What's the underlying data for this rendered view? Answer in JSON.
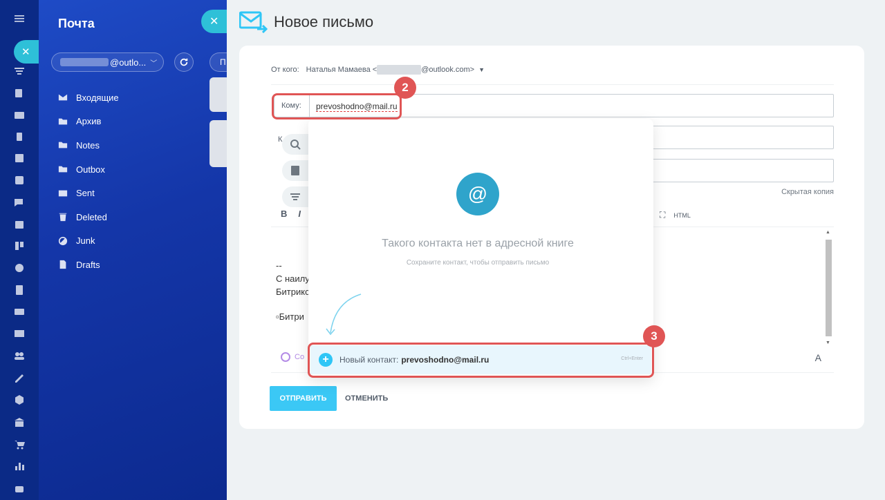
{
  "sidebar": {
    "icons": [
      "menu-icon",
      "filter-icon",
      "tasks-icon",
      "contacts-icon",
      "widgets-icon",
      "feed-icon",
      "checklist-icon",
      "chat-icon",
      "calendar-icon",
      "kanban-icon",
      "goals-icon",
      "document-icon",
      "store-icon",
      "mail-icon",
      "team-icon",
      "signature-icon",
      "hexagon-icon",
      "bank-icon",
      "cart-icon",
      "analytics-icon",
      "robot-icon"
    ]
  },
  "mail": {
    "title": "Почта",
    "account_suffix": "@outlo...",
    "peek_label": "П",
    "folders": [
      {
        "label": "Входящие",
        "icon": "inbox-icon"
      },
      {
        "label": "Архив",
        "icon": "folder-icon"
      },
      {
        "label": "Notes",
        "icon": "folder-icon"
      },
      {
        "label": "Outbox",
        "icon": "folder-icon"
      },
      {
        "label": "Sent",
        "icon": "sent-icon"
      },
      {
        "label": "Deleted",
        "icon": "trash-icon"
      },
      {
        "label": "Junk",
        "icon": "block-icon"
      },
      {
        "label": "Drafts",
        "icon": "drafts-icon"
      }
    ]
  },
  "compose": {
    "title": "Новое письмо",
    "from_label": "От кого:",
    "from_name": "Наталья Мамаева <",
    "from_domain": "@outlook.com>",
    "to_label": "Кому:",
    "to_value": "prevoshodno@mail.ru",
    "cc_label": "К",
    "bcc_link": "Скрытая копия",
    "toolbar_bold": "B",
    "toolbar_italic": "I",
    "toolbar_html": "HTML",
    "body_lines": [
      "--",
      "С наилу",
      "Битрикс"
    ],
    "body_image_alt": "Битри",
    "copilot": "Co",
    "font_btn": "A",
    "send_label": "ОТПРАВИТЬ",
    "cancel_label": "ОТМЕНИТЬ"
  },
  "popup": {
    "icon": "@",
    "title": "Такого контакта нет в адресной книге",
    "subtitle": "Сохраните контакт, чтобы отправить письмо",
    "new_contact_label": "Новый контакт:",
    "new_contact_email": "prevoshodno@mail.ru",
    "shortcut": "Ctrl+Enter"
  },
  "annotations": {
    "badge_to": "2",
    "badge_new_contact": "3"
  },
  "colors": {
    "accent": "#3bc8f5",
    "badge": "#e05555",
    "at_circle": "#2fa4cb"
  }
}
